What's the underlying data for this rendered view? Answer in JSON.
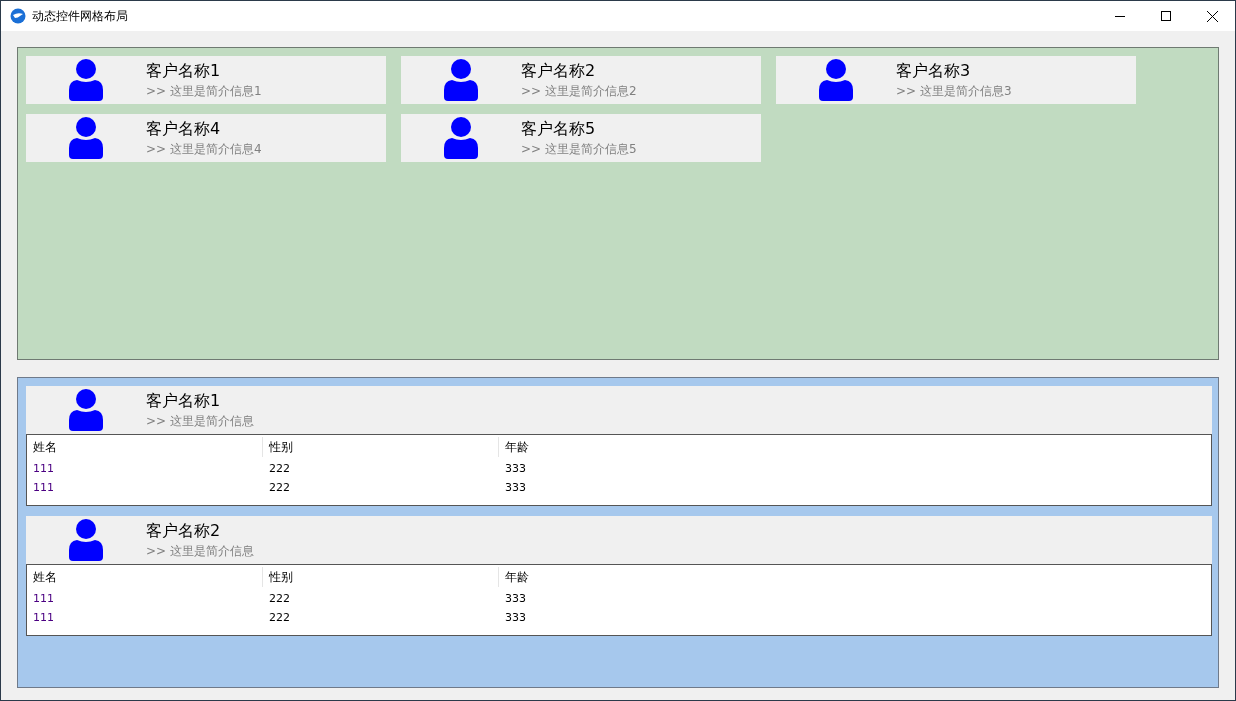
{
  "window": {
    "title": "动态控件网格布局"
  },
  "grid_cards": [
    {
      "name": "客户名称1",
      "intro": ">> 这里是简介信息1"
    },
    {
      "name": "客户名称2",
      "intro": ">> 这里是简介信息2"
    },
    {
      "name": "客户名称3",
      "intro": ">> 这里是简介信息3"
    },
    {
      "name": "客户名称4",
      "intro": ">> 这里是简介信息4"
    },
    {
      "name": "客户名称5",
      "intro": ">> 这里是简介信息5"
    }
  ],
  "detail_sections": [
    {
      "name": "客户名称1",
      "intro": ">> 这里是简介信息",
      "columns": [
        "姓名",
        "性别",
        "年龄"
      ],
      "rows": [
        [
          "111",
          "222",
          "333"
        ],
        [
          "111",
          "222",
          "333"
        ]
      ]
    },
    {
      "name": "客户名称2",
      "intro": ">> 这里是简介信息",
      "columns": [
        "姓名",
        "性别",
        "年龄"
      ],
      "rows": [
        [
          "111",
          "222",
          "333"
        ],
        [
          "111",
          "222",
          "333"
        ]
      ]
    }
  ]
}
